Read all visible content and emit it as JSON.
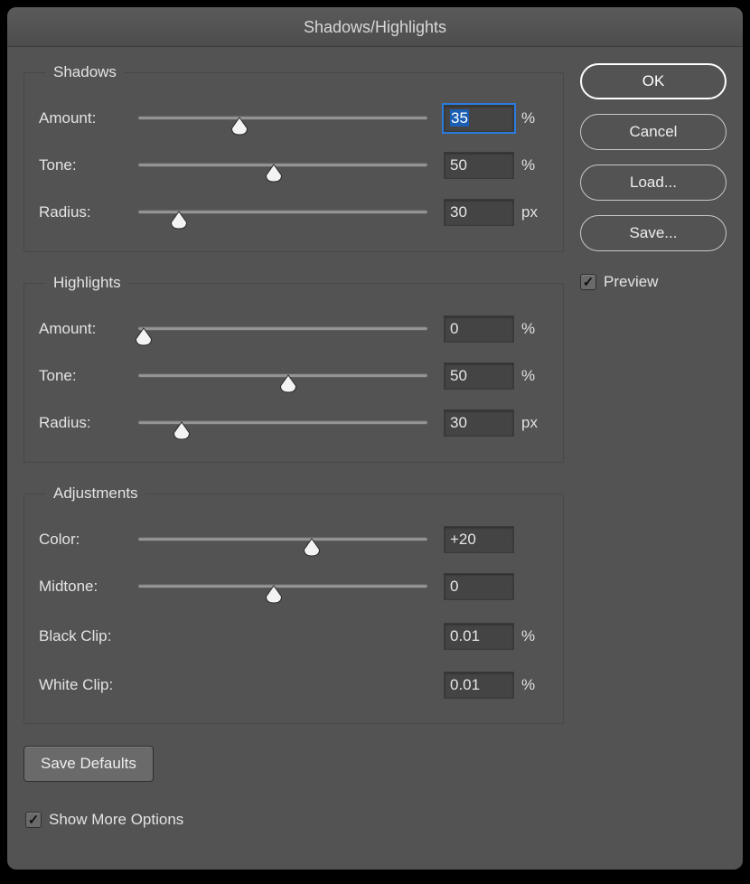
{
  "title": "Shadows/Highlights",
  "shadows": {
    "legend": "Shadows",
    "amount": {
      "label": "Amount:",
      "value": "35",
      "unit": "%",
      "pos": 35
    },
    "tone": {
      "label": "Tone:",
      "value": "50",
      "unit": "%",
      "pos": 47
    },
    "radius": {
      "label": "Radius:",
      "value": "30",
      "unit": "px",
      "pos": 14
    }
  },
  "highlights": {
    "legend": "Highlights",
    "amount": {
      "label": "Amount:",
      "value": "0",
      "unit": "%",
      "pos": 2
    },
    "tone": {
      "label": "Tone:",
      "value": "50",
      "unit": "%",
      "pos": 52
    },
    "radius": {
      "label": "Radius:",
      "value": "30",
      "unit": "px",
      "pos": 15
    }
  },
  "adjustments": {
    "legend": "Adjustments",
    "color": {
      "label": "Color:",
      "value": "+20",
      "pos": 60
    },
    "midtone": {
      "label": "Midtone:",
      "value": "0",
      "pos": 47
    },
    "black_clip": {
      "label": "Black Clip:",
      "value": "0.01",
      "unit": "%"
    },
    "white_clip": {
      "label": "White Clip:",
      "value": "0.01",
      "unit": "%"
    }
  },
  "buttons": {
    "ok": "OK",
    "cancel": "Cancel",
    "load": "Load...",
    "save": "Save...",
    "save_defaults": "Save Defaults"
  },
  "preview": {
    "label": "Preview",
    "checked": true
  },
  "show_more": {
    "label": "Show More Options",
    "checked": true
  }
}
